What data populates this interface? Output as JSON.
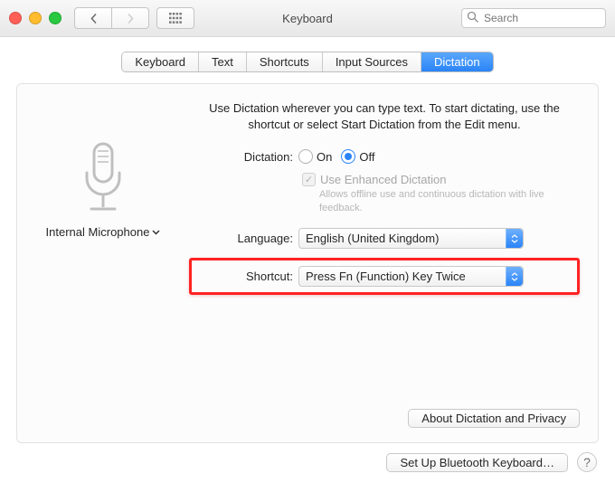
{
  "header": {
    "title": "Keyboard",
    "search_placeholder": "Search"
  },
  "tabs": [
    "Keyboard",
    "Text",
    "Shortcuts",
    "Input Sources",
    "Dictation"
  ],
  "left": {
    "device": "Internal Microphone"
  },
  "main": {
    "instruction": "Use Dictation wherever you can type text. To start dictating, use the shortcut or select Start Dictation from the Edit menu.",
    "dictation_label": "Dictation:",
    "on_label": "On",
    "off_label": "Off",
    "dictation_selected": "Off",
    "enhanced_label": "Use Enhanced Dictation",
    "enhanced_checked": true,
    "enhanced_sub": "Allows offline use and continuous dictation with live feedback.",
    "language_label": "Language:",
    "language_value": "English (United Kingdom)",
    "shortcut_label": "Shortcut:",
    "shortcut_value": "Press Fn (Function) Key Twice",
    "about_button": "About Dictation and Privacy"
  },
  "footer": {
    "bluetooth_button": "Set Up Bluetooth Keyboard…",
    "help_glyph": "?"
  },
  "annotation": {
    "highlight_color": "#ff2323"
  }
}
